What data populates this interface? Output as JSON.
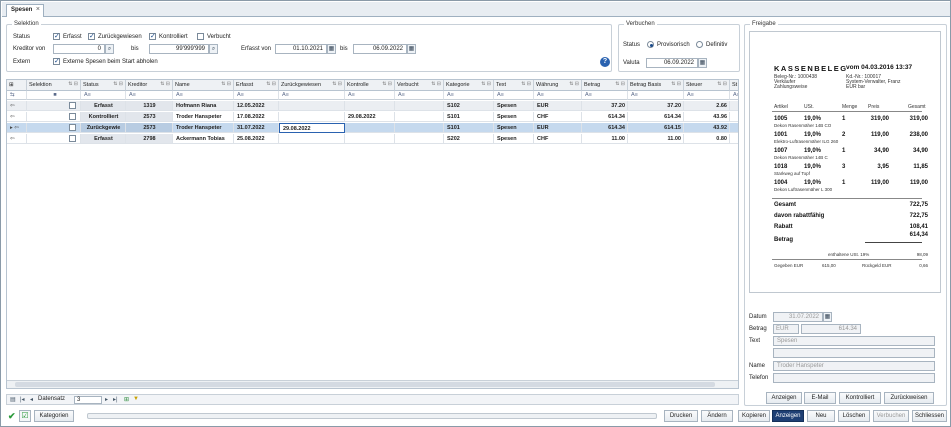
{
  "tab": {
    "label": "Spesen"
  },
  "selektion": {
    "title": "Selektion",
    "status_label": "Status",
    "checks": [
      {
        "label": "Erfasst",
        "checked": true
      },
      {
        "label": "Zurückgewiesen",
        "checked": true
      },
      {
        "label": "Kontrolliert",
        "checked": true
      },
      {
        "label": "Verbucht",
        "checked": false
      }
    ],
    "kreditor_von_label": "Kreditor von",
    "kreditor_von_value": "0",
    "bis_label": "bis",
    "kreditor_bis_value": "99'999'999",
    "erfasst_von_label": "Erfasst von",
    "erfasst_von_value": "01.10.2021",
    "erfasst_bis_label": "bis",
    "erfasst_bis_value": "06.09.2022",
    "extern_label": "Extern",
    "extern_check_label": "Externe Spesen beim Start abholen",
    "extern_checked": true
  },
  "verbuchen": {
    "title": "Verbuchen",
    "status_label": "Status",
    "radio1": "Provisorisch",
    "radio2": "Definitiv",
    "valuta_label": "Valuta",
    "valuta_value": "06.09.2022"
  },
  "grid": {
    "columns": [
      "Selektion",
      "Status",
      "Kreditor",
      "Name",
      "Erfasst",
      "Zurückgewiesen",
      "Kontrolle",
      "Verbucht",
      "Kategorie",
      "Text",
      "Währung",
      "Betrag",
      "Betrag Basis",
      "Steuer",
      "St"
    ],
    "filter_symbol": "A≡",
    "rows": [
      {
        "status": "Erfasst",
        "kreditor": "1319",
        "name": "Hofmann Riana",
        "erfasst": "12.05.2022",
        "zurueck": "",
        "kontrolle": "",
        "verbucht": "",
        "kategorie": "S102",
        "text": "Spesen",
        "waehrung": "EUR",
        "betrag": "37.20",
        "basis": "37.20",
        "steuer": "2.66"
      },
      {
        "status": "Kontrolliert",
        "kreditor": "2573",
        "name": "Troder Hanspeter",
        "erfasst": "17.08.2022",
        "zurueck": "",
        "kontrolle": "29.08.2022",
        "verbucht": "",
        "kategorie": "S101",
        "text": "Spesen",
        "waehrung": "CHF",
        "betrag": "614.34",
        "basis": "614.34",
        "steuer": "43.96"
      },
      {
        "status": "Zurückgewie",
        "kreditor": "2573",
        "name": "Troder Hanspeter",
        "erfasst": "31.07.2022",
        "zurueck": "29.08.2022",
        "kontrolle": "",
        "verbucht": "",
        "kategorie": "S101",
        "text": "Spesen",
        "waehrung": "EUR",
        "betrag": "614.34",
        "basis": "614.15",
        "steuer": "43.92"
      },
      {
        "status": "Erfasst",
        "kreditor": "2798",
        "name": "Ackermann Tobias",
        "erfasst": "25.08.2022",
        "zurueck": "",
        "kontrolle": "",
        "verbucht": "",
        "kategorie": "S202",
        "text": "Spesen",
        "waehrung": "CHF",
        "betrag": "11.00",
        "basis": "11.00",
        "steuer": "0.80"
      }
    ],
    "nav_label": "Datensatz",
    "nav_value": "3"
  },
  "freigabe": {
    "title": "Freigabe",
    "receipt": {
      "heading": "KASSENBELEG",
      "heading_date": "vom 04.03.2016 13:37",
      "meta_left": [
        "Beleg-Nr.: 1000438",
        "Verkäufer",
        "Zahlungsweise"
      ],
      "meta_right": [
        "Kd.-Nr.: 100017",
        "System-Verwalter, Franz",
        "EUR  bar"
      ],
      "col_headers": [
        "Artikel",
        "USt.",
        "Menge",
        "Preis",
        "Gesamt"
      ],
      "items": [
        {
          "nr": "1005",
          "ust": "19,0%",
          "menge": "1",
          "preis": "319,00",
          "gesamt": "319,00",
          "desc": "Dekon Rasenmäher 14B CO"
        },
        {
          "nr": "1001",
          "ust": "19,0%",
          "menge": "2",
          "preis": "119,00",
          "gesamt": "238,00",
          "desc": "Elektro-Luftrasenmäher ILG 260"
        },
        {
          "nr": "1007",
          "ust": "19,0%",
          "menge": "1",
          "preis": "34,90",
          "gesamt": "34,90",
          "desc": "Dekon Rasenmäher 14B C"
        },
        {
          "nr": "1018",
          "ust": "19,0%",
          "menge": "3",
          "preis": "3,95",
          "gesamt": "11,85",
          "desc": "Starkweg auf Topf"
        },
        {
          "nr": "1004",
          "ust": "19,0%",
          "menge": "1",
          "preis": "119,00",
          "gesamt": "119,00",
          "desc": "Dekon Luftrasenmäher L 300"
        }
      ],
      "gesamt_label": "Gesamt",
      "gesamt_value": "722,75",
      "rabatt_faehig_label": "davon rabattfähig",
      "rabatt_faehig_value": "722,75",
      "rabatt_label": "Rabatt",
      "rabatt_value": "108,41",
      "betrag_value": "614,34",
      "betrag_label": "Betrag",
      "ust_label": "enthaltene USt. 19%",
      "ust_value": "98,09",
      "gegeben_label": "Gegeben   EUR",
      "gegeben_value": "615,00",
      "rueckgeld_label": "Rückgeld EUR",
      "rueckgeld_value": "0,66"
    },
    "datum_label": "Datum",
    "datum_value": "31.07.2022",
    "betrag_label": "Betrag",
    "betrag_currency": "EUR",
    "betrag_value": "614.34",
    "text_label": "Text",
    "text_value": "Spesen",
    "name_label": "Name",
    "name_value": "Troder Hanspeter",
    "telefon_label": "Telefon",
    "buttons": [
      "Anzeigen",
      "E-Mail",
      "Kontrolliert",
      "Zurückweisen"
    ]
  },
  "bottom": {
    "kategorien": "Kategorien",
    "drucken": "Drucken",
    "aendern": "Ändern",
    "kopieren": "Kopieren",
    "anzeigen": "Anzeigen",
    "neu": "Neu",
    "loeschen": "Löschen",
    "verbuchen": "Verbuchen",
    "schliessen": "Schliessen"
  }
}
